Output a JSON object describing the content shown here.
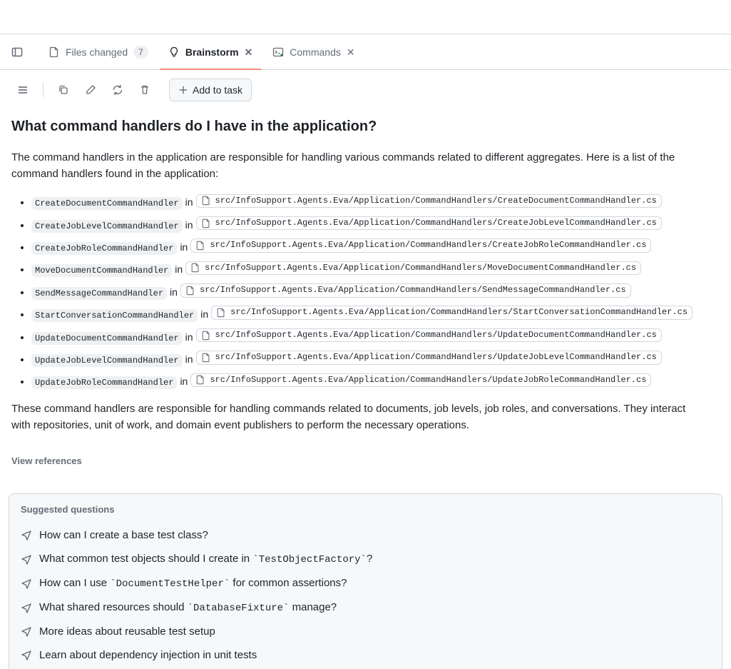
{
  "tabs": {
    "files_changed": {
      "label": "Files changed",
      "count": "7"
    },
    "brainstorm": {
      "label": "Brainstorm"
    },
    "commands": {
      "label": "Commands"
    }
  },
  "toolbar": {
    "add_to_task": "Add to task"
  },
  "question": "What command handlers do I have in the application?",
  "intro": "The command handlers in the application are responsible for handling various commands related to different aggregates. Here is a list of the command handlers found in the application:",
  "in_word": "in",
  "handlers": [
    {
      "name": "CreateDocumentCommandHandler",
      "path": "src/InfoSupport.Agents.Eva/Application/CommandHandlers/CreateDocumentCommandHandler.cs"
    },
    {
      "name": "CreateJobLevelCommandHandler",
      "path": "src/InfoSupport.Agents.Eva/Application/CommandHandlers/CreateJobLevelCommandHandler.cs"
    },
    {
      "name": "CreateJobRoleCommandHandler",
      "path": "src/InfoSupport.Agents.Eva/Application/CommandHandlers/CreateJobRoleCommandHandler.cs"
    },
    {
      "name": "MoveDocumentCommandHandler",
      "path": "src/InfoSupport.Agents.Eva/Application/CommandHandlers/MoveDocumentCommandHandler.cs"
    },
    {
      "name": "SendMessageCommandHandler",
      "path": "src/InfoSupport.Agents.Eva/Application/CommandHandlers/SendMessageCommandHandler.cs"
    },
    {
      "name": "StartConversationCommandHandler",
      "path": "src/InfoSupport.Agents.Eva/Application/CommandHandlers/StartConversationCommandHandler.cs"
    },
    {
      "name": "UpdateDocumentCommandHandler",
      "path": "src/InfoSupport.Agents.Eva/Application/CommandHandlers/UpdateDocumentCommandHandler.cs"
    },
    {
      "name": "UpdateJobLevelCommandHandler",
      "path": "src/InfoSupport.Agents.Eva/Application/CommandHandlers/UpdateJobLevelCommandHandler.cs"
    },
    {
      "name": "UpdateJobRoleCommandHandler",
      "path": "src/InfoSupport.Agents.Eva/Application/CommandHandlers/UpdateJobRoleCommandHandler.cs"
    }
  ],
  "outro": "These command handlers are responsible for handling commands related to documents, job levels, job roles, and conversations. They interact with repositories, unit of work, and domain event publishers to perform the necessary operations.",
  "view_references": "View references",
  "suggested": {
    "title": "Suggested questions",
    "items": [
      "How can I create a base test class?",
      "What common test objects should I create in `TestObjectFactory`?",
      "How can I use `DocumentTestHelper` for common assertions?",
      "What shared resources should `DatabaseFixture` manage?",
      "More ideas about reusable test setup",
      "Learn about dependency injection in unit tests"
    ]
  }
}
